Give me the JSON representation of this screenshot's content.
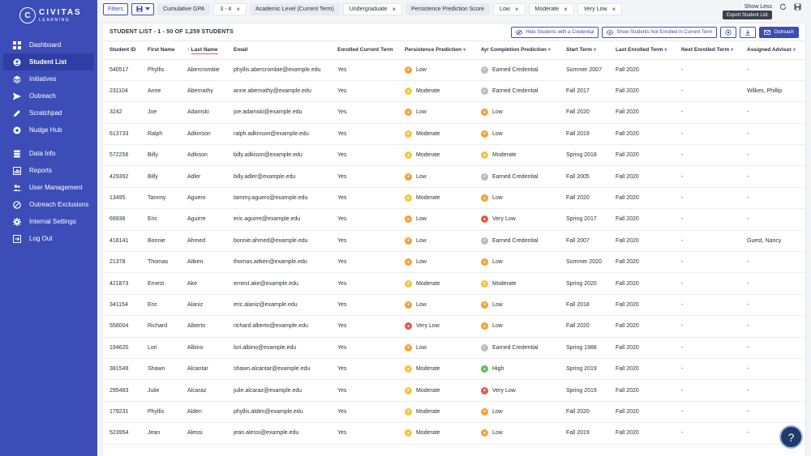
{
  "sidebar": {
    "logo_mark": "C",
    "logo_line1": "CIVITAS",
    "logo_line2": "LEARNING",
    "items_a": [
      {
        "label": "Dashboard",
        "icon": "grid-icon"
      },
      {
        "label": "Student List",
        "icon": "student-icon",
        "active": true
      },
      {
        "label": "Initiatives",
        "icon": "layers-icon"
      },
      {
        "label": "Outreach",
        "icon": "send-icon"
      },
      {
        "label": "Scratchpad",
        "icon": "pencil-icon"
      },
      {
        "label": "Nudge Hub",
        "icon": "nudge-icon"
      }
    ],
    "items_b": [
      {
        "label": "Data Info",
        "icon": "database-icon"
      },
      {
        "label": "Reports",
        "icon": "chart-icon"
      },
      {
        "label": "User Management",
        "icon": "users-icon"
      },
      {
        "label": "Outreach Exclusions",
        "icon": "exclusion-icon"
      },
      {
        "label": "Internal Settings",
        "icon": "gear-icon"
      },
      {
        "label": "Log Out",
        "icon": "logout-icon"
      }
    ]
  },
  "filters": {
    "filters_label": "Filters",
    "chips": [
      {
        "label": "Cumulative GPA",
        "light": false,
        "closable": false
      },
      {
        "label": "3 - 4",
        "light": true,
        "closable": true
      },
      {
        "label": "Academic Level (Current Term)",
        "light": false,
        "closable": false
      },
      {
        "label": "Undergraduate",
        "light": true,
        "closable": true
      },
      {
        "label": "Persistence Prediction Score",
        "light": false,
        "closable": false
      },
      {
        "label": "Low",
        "light": true,
        "closable": true
      },
      {
        "label": "Moderate",
        "light": true,
        "closable": true
      },
      {
        "label": "Very Low",
        "light": true,
        "closable": true
      }
    ],
    "show_less": "Show Less"
  },
  "panel": {
    "title": "STUDENT LIST - 1 - 50 OF 1,259 STUDENTS",
    "hide_credential": "Hide Students with a Credential",
    "show_not_enrolled": "Show Students Not Enrolled in Current Term",
    "outreach": "Outreach",
    "tooltip": "Export Student List"
  },
  "table": {
    "columns": [
      "Student ID",
      "First Name",
      "Last Name",
      "Email",
      "Enrolled Current Term",
      "Persistence Prediction",
      "4yr Completion Prediction",
      "Start Term",
      "Last Enrolled Term",
      "Next Enrolled Term",
      "Assigned Advisor"
    ],
    "rows": [
      [
        "540517",
        "Phyllis",
        "Abercrombie",
        "phyllis.abercrombie@example.edu",
        "Yes",
        "Low",
        "Earned Credential",
        "Summer 2007",
        "Fall 2020",
        "-",
        "-"
      ],
      [
        "231104",
        "Anne",
        "Abernathy",
        "anne.abernathy@example.edu",
        "Yes",
        "Moderate",
        "Earned Credential",
        "Fall 2017",
        "Fall 2020",
        "-",
        "Wilkes, Phillip"
      ],
      [
        "3242",
        "Joe",
        "Adamski",
        "joe.adamski@example.edu",
        "Yes",
        "Low",
        "Low",
        "Fall 2020",
        "Fall 2020",
        "-",
        "-"
      ],
      [
        "613733",
        "Ralph",
        "Adkinson",
        "ralph.adkinson@example.edu",
        "Yes",
        "Moderate",
        "Low",
        "Fall 2019",
        "Fall 2020",
        "-",
        "-"
      ],
      [
        "572256",
        "Billy",
        "Adkison",
        "billy.adkison@example.edu",
        "Yes",
        "Moderate",
        "Moderate",
        "Spring 2018",
        "Fall 2020",
        "-",
        "-"
      ],
      [
        "429392",
        "Billy",
        "Adler",
        "billy.adler@example.edu",
        "Yes",
        "Low",
        "Earned Credential",
        "Fall 2005",
        "Fall 2020",
        "-",
        "-"
      ],
      [
        "13495",
        "Tammy",
        "Aguero",
        "tammy.aguero@example.edu",
        "Yes",
        "Moderate",
        "Low",
        "Fall 2020",
        "Fall 2020",
        "-",
        "-"
      ],
      [
        "69936",
        "Eric",
        "Aguirre",
        "eric.aguirre@example.edu",
        "Yes",
        "Low",
        "Very Low",
        "Spring 2017",
        "Fall 2020",
        "-",
        "-"
      ],
      [
        "418141",
        "Bonnie",
        "Ahmed",
        "bonnie.ahmed@example.edu",
        "Yes",
        "Low",
        "Earned Credential",
        "Fall 2007",
        "Fall 2020",
        "-",
        "Guest, Nancy"
      ],
      [
        "21378",
        "Thomas",
        "Aitken",
        "thomas.aitken@example.edu",
        "Yes",
        "Low",
        "Low",
        "Summer 2020",
        "Fall 2020",
        "-",
        "-"
      ],
      [
        "421873",
        "Ernest",
        "Ake",
        "ernest.ake@example.edu",
        "Yes",
        "Moderate",
        "Moderate",
        "Spring 2020",
        "Fall 2020",
        "-",
        "-"
      ],
      [
        "341154",
        "Eric",
        "Alaniz",
        "eric.alaniz@example.edu",
        "Yes",
        "Low",
        "Low",
        "Fall 2018",
        "Fall 2020",
        "-",
        "-"
      ],
      [
        "558004",
        "Richard",
        "Alberto",
        "richard.alberto@example.edu",
        "Yes",
        "Very Low",
        "Low",
        "Fall 2020",
        "Fall 2020",
        "-",
        "-"
      ],
      [
        "194620",
        "Lori",
        "Albino",
        "lori.albino@example.edu",
        "Yes",
        "Low",
        "Earned Credential",
        "Spring 1988",
        "Fall 2020",
        "-",
        "-"
      ],
      [
        "381549",
        "Shawn",
        "Alcantar",
        "shawn.alcantar@example.edu",
        "Yes",
        "Moderate",
        "High",
        "Spring 2019",
        "Fall 2020",
        "-",
        "-"
      ],
      [
        "295483",
        "Julie",
        "Alcaraz",
        "julie.alcaraz@example.edu",
        "Yes",
        "Moderate",
        "Very Low",
        "Spring 2019",
        "Fall 2020",
        "-",
        "-"
      ],
      [
        "179231",
        "Phyllis",
        "Alden",
        "phyllis.alden@example.edu",
        "Yes",
        "Moderate",
        "Low",
        "Fall 2020",
        "Fall 2020",
        "-",
        "-"
      ],
      [
        "523954",
        "Jean",
        "Alessi",
        "jean.alessi@example.edu",
        "Yes",
        "Moderate",
        "Low",
        "Fall 2019",
        "Fall 2020",
        "-",
        "-"
      ]
    ]
  },
  "colors": {
    "sidebar": "#3c4db8",
    "accent": "#3c4db8",
    "low": "#f2a33a",
    "moderate": "#f3c640",
    "very_low": "#e25b4a",
    "high": "#5cbf5c",
    "earned": "#b8bcc6"
  }
}
